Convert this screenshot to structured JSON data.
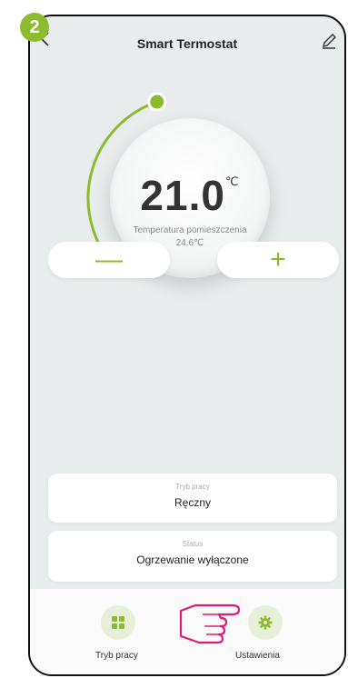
{
  "step": "2",
  "header": {
    "title": "Smart Termostat",
    "back_icon": "chevron-left-icon",
    "edit_icon": "pencil-icon"
  },
  "thermostat": {
    "setpoint": "21.0",
    "unit": "℃",
    "room_label": "Temperatura pomieszczenia",
    "room_temp": "24.6℃",
    "arc_fraction": 0.43
  },
  "controls": {
    "minus_label": "—",
    "plus_label": "+"
  },
  "cards": {
    "mode_label": "Tryb pracy",
    "mode_value": "Ręczny",
    "status_label": "Status",
    "status_value": "Ogrzewanie wyłączone"
  },
  "bottom_nav": {
    "mode_label": "Tryb pracy",
    "settings_label": "Ustawienia",
    "mode_icon": "grid-icon",
    "settings_icon": "gear-icon"
  },
  "colors": {
    "accent": "#8dbb2e",
    "background": "#e9eced"
  }
}
